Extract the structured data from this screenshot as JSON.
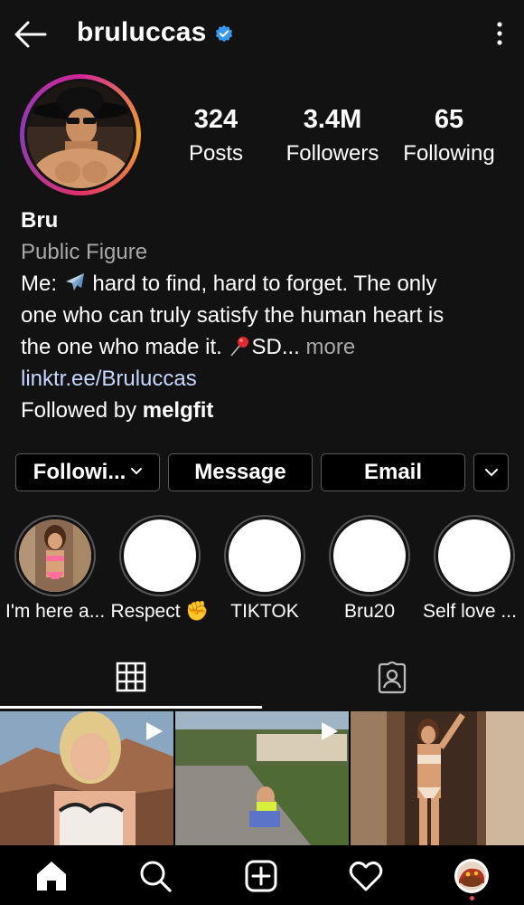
{
  "header": {
    "username": "bruluccas",
    "verified": true,
    "back_icon": "arrow-left-icon",
    "menu_icon": "kebab-menu-icon"
  },
  "stats": {
    "posts": {
      "value": "324",
      "label": "Posts"
    },
    "followers": {
      "value": "3.4M",
      "label": "Followers"
    },
    "following": {
      "value": "65",
      "label": "Following"
    }
  },
  "bio": {
    "name": "Bru",
    "category": "Public Figure",
    "line1_prefix": "Me: ",
    "line1_suffix": " hard to find, hard to forget. The only",
    "line2": "one who can truly satisfy the human heart is",
    "line3_prefix": "the one who made it. ",
    "line3_suffix": "SD...",
    "more": "more",
    "link": "linktr.ee/Bruluccas",
    "followed_by_prefix": "Followed by ",
    "followed_by_user": "melgfit"
  },
  "buttons": {
    "following": "Followi...",
    "message": "Message",
    "email": "Email"
  },
  "highlights": [
    {
      "label": "I'm here a..."
    },
    {
      "label": "Respect ✊"
    },
    {
      "label": "TIKTOK"
    },
    {
      "label": "Bru20"
    },
    {
      "label": "Self love ..."
    }
  ],
  "tabs": [
    {
      "icon": "grid-icon",
      "active": true
    },
    {
      "icon": "tagged-person-icon",
      "active": false
    }
  ],
  "posts": [
    {
      "type": "video"
    },
    {
      "type": "video"
    },
    {
      "type": "photo"
    }
  ],
  "bottom_nav": [
    {
      "icon": "home-icon"
    },
    {
      "icon": "search-icon"
    },
    {
      "icon": "new-post-icon"
    },
    {
      "icon": "heart-icon"
    },
    {
      "icon": "profile-avatar-icon"
    }
  ],
  "colors": {
    "background": "#121212",
    "verified_blue": "#3897f0",
    "link": "#c7d7ff",
    "muted_text": "#a8a8a8",
    "notification_dot": "#ed4956"
  }
}
